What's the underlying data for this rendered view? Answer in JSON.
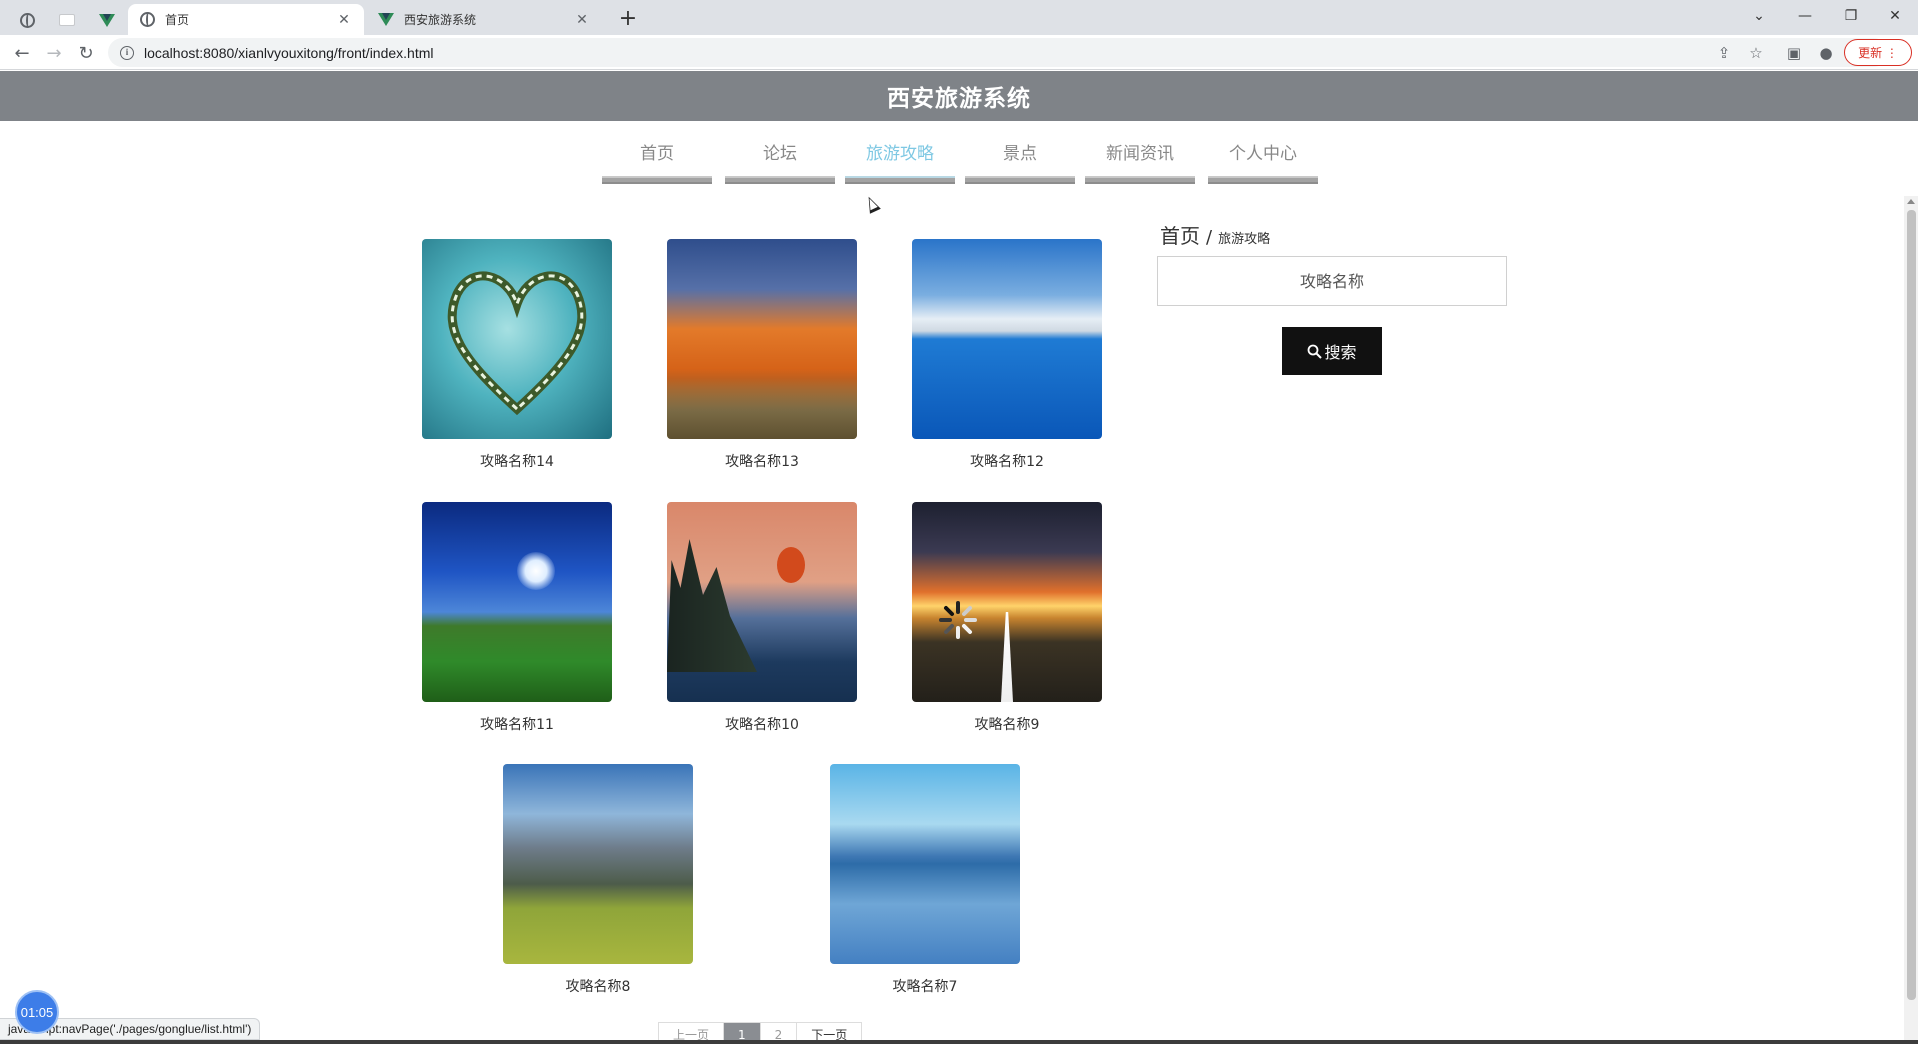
{
  "browser": {
    "tabs": [
      {
        "title": "首页",
        "active": true
      },
      {
        "title": "西安旅游系统",
        "active": false
      }
    ],
    "url": "localhost:8080/xianlvyouxitong/front/index.html",
    "update_label": "更新",
    "status_text": "javascript:navPage('./pages/gonglue/list.html')"
  },
  "site": {
    "title": "西安旅游系统",
    "nav": [
      "首页",
      "论坛",
      "旅游攻略",
      "景点",
      "新闻资讯",
      "个人中心"
    ],
    "active_nav": "旅游攻略"
  },
  "breadcrumb": {
    "home": "首页",
    "separator": "/",
    "current": "旅游攻略"
  },
  "search": {
    "placeholder": "攻略名称",
    "button_label": "搜索"
  },
  "cards": [
    {
      "title": "攻略名称14",
      "image": "heart-island"
    },
    {
      "title": "攻略名称13",
      "image": "orange-mountain"
    },
    {
      "title": "攻略名称12",
      "image": "blue-lake"
    },
    {
      "title": "攻略名称11",
      "image": "moonlit-field"
    },
    {
      "title": "攻略名称10",
      "image": "moon-lakeshore"
    },
    {
      "title": "攻略名称9",
      "image": "sunset-road"
    },
    {
      "title": "攻略名称8",
      "image": "hay-mountain"
    },
    {
      "title": "攻略名称7",
      "image": "calm-lake-boat"
    }
  ],
  "pagination": {
    "prev": "上一页",
    "pages": [
      "1",
      "2"
    ],
    "current": "1",
    "next": "下一页"
  },
  "timer": "01:05"
}
